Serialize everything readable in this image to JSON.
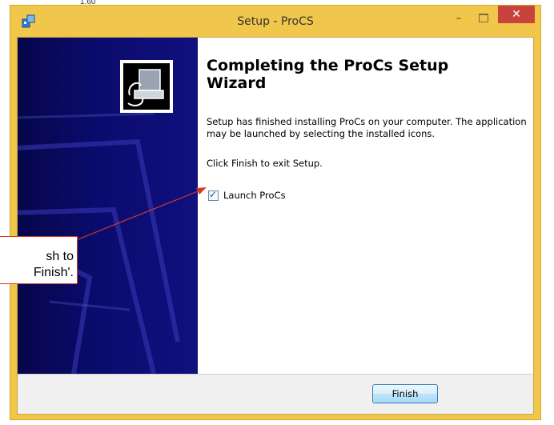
{
  "window": {
    "title": "Setup - ProCS",
    "minimize_glyph": "–",
    "close_glyph": "✕"
  },
  "top_fragment": "1.60",
  "wizard": {
    "heading": "Completing the ProCs Setup Wizard",
    "description": "Setup has finished installing ProCs on your computer. The application may be launched by selecting the installed icons.",
    "exit_text": "Click Finish to exit Setup.",
    "launch_checkbox": {
      "label": "Launch ProCs",
      "checked": true
    }
  },
  "buttons": {
    "finish": "Finish"
  },
  "callout": {
    "line1": "sh to",
    "line2": "Finish'."
  },
  "icons": {
    "app": "setup-installer-icon",
    "wizard": "computer-install-icon",
    "checkbox_mark": "✓"
  },
  "colors": {
    "titlebar": "#f0c64b",
    "close": "#c7433b",
    "panel": "#0b0b6e",
    "annotation": "#d23b2c"
  }
}
